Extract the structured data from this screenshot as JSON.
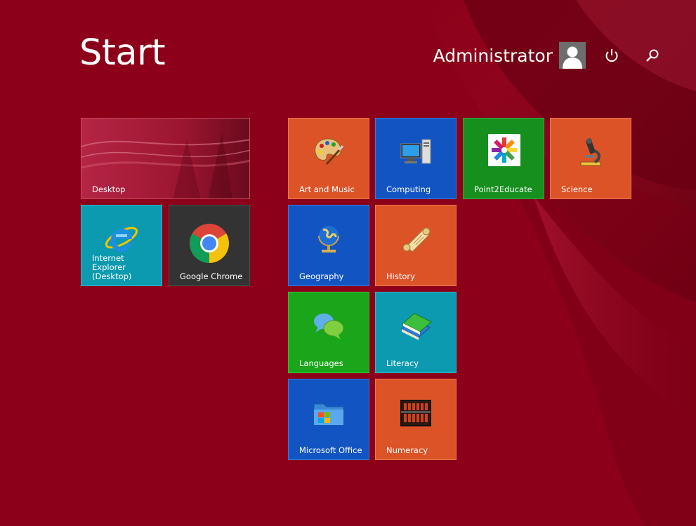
{
  "screen": {
    "title": "Start"
  },
  "header": {
    "user_name": "Administrator",
    "avatar_icon": "user-avatar-icon",
    "power_icon": "power-icon",
    "search_icon": "search-icon"
  },
  "colors": {
    "background": "#8c0019",
    "orange_tile": "#dc5328",
    "blue_tile": "#1255c2",
    "green_tile": "#168f1f",
    "teal_tile": "#0c9ab0",
    "dark_tile": "#333333"
  },
  "tiles": {
    "desktop": {
      "label": "Desktop"
    },
    "internet_explorer": {
      "label": "Internet Explorer (Desktop)"
    },
    "google_chrome": {
      "label": "Google Chrome"
    },
    "art_and_music": {
      "label": "Art and Music"
    },
    "computing": {
      "label": "Computing"
    },
    "point2educate": {
      "label": "Point2Educate"
    },
    "science": {
      "label": "Science"
    },
    "geography": {
      "label": "Geography"
    },
    "history": {
      "label": "History"
    },
    "languages": {
      "label": "Languages"
    },
    "literacy": {
      "label": "Literacy"
    },
    "microsoft_office": {
      "label": "Microsoft Office"
    },
    "numeracy": {
      "label": "Numeracy"
    }
  }
}
